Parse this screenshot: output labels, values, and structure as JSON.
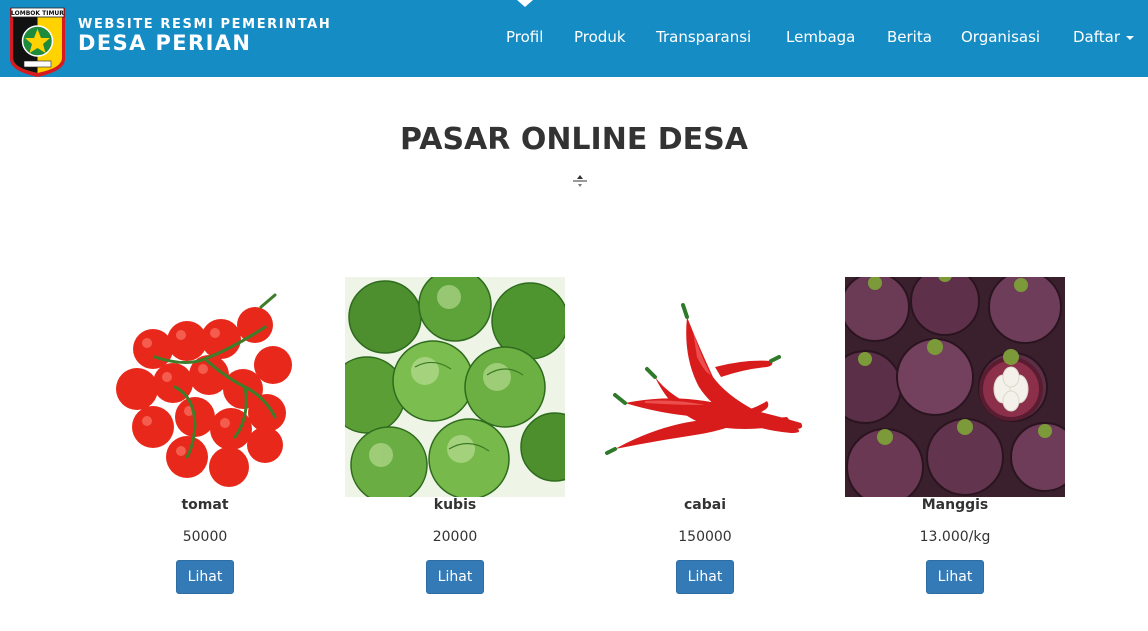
{
  "header": {
    "logo_text": "LOMBOK TIMUR",
    "subtitle": "WEBSITE RESMI PEMERINTAH",
    "title": "DESA PERIAN"
  },
  "nav": {
    "items": [
      "Profil",
      "Produk",
      "Transparansi",
      "Lembaga",
      "Berita",
      "Organisasi",
      "Daftar"
    ]
  },
  "main": {
    "title": "PASAR ONLINE DESA",
    "products": [
      {
        "name": "tomat",
        "price": "50000",
        "button": "Lihat",
        "image_icon": "tomato-image"
      },
      {
        "name": "kubis",
        "price": "20000",
        "button": "Lihat",
        "image_icon": "cabbage-image"
      },
      {
        "name": "cabai",
        "price": "150000",
        "button": "Lihat",
        "image_icon": "chili-image"
      },
      {
        "name": "Manggis",
        "price": "13.000/kg",
        "button": "Lihat",
        "image_icon": "mangosteen-image"
      }
    ]
  },
  "colors": {
    "navbar": "#168cc4",
    "button": "#337ab7",
    "text": "#333333"
  }
}
